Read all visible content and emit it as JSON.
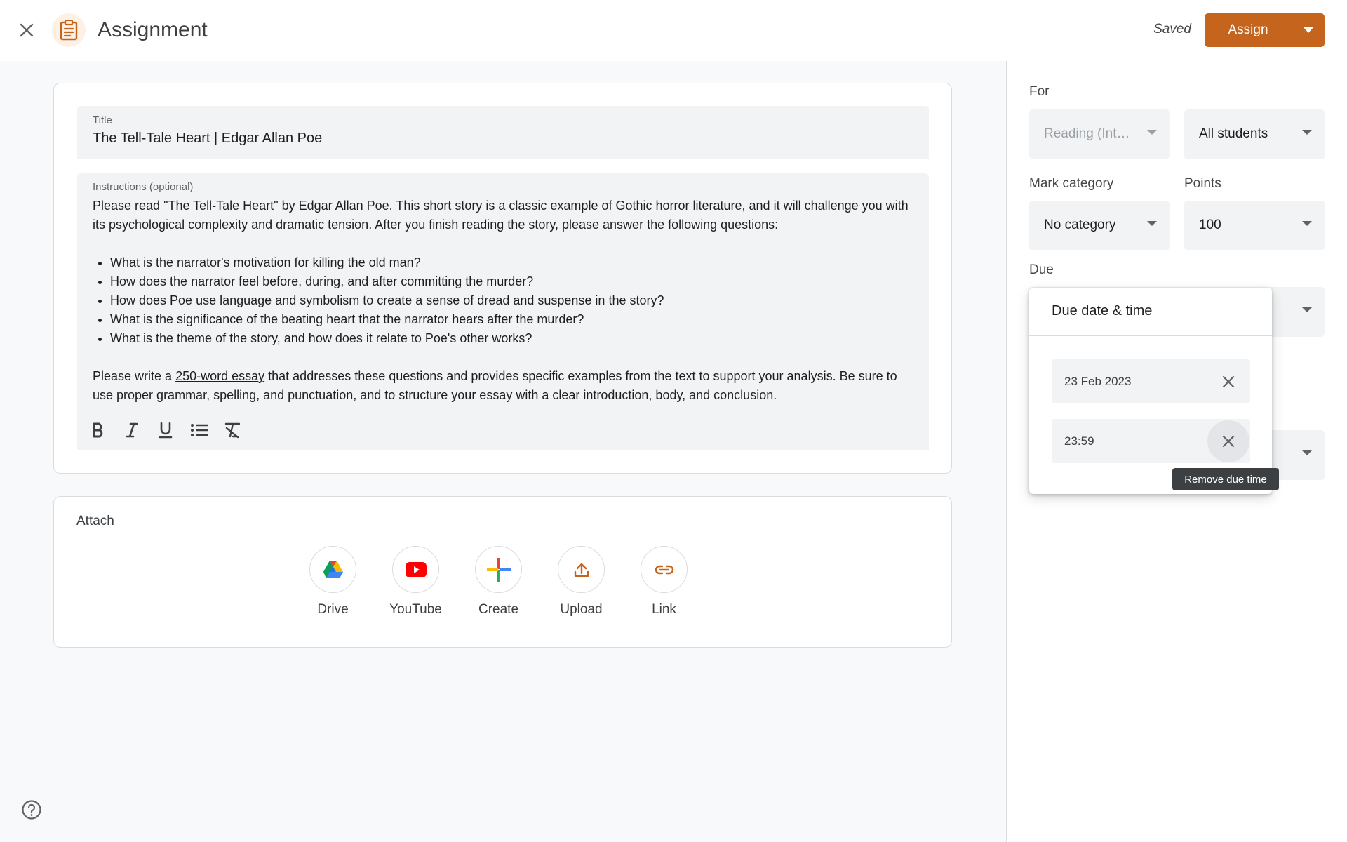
{
  "header": {
    "title": "Assignment",
    "status": "Saved",
    "assign_label": "Assign",
    "icons": {
      "close": "close-icon",
      "app": "assignment-icon",
      "dropdown": "caret-down-icon"
    }
  },
  "details": {
    "title_label": "Title",
    "title_value": "The Tell-Tale Heart | Edgar Allan Poe",
    "instructions_label": "Instructions (optional)",
    "instructions_intro": "Please read \"The Tell-Tale Heart\" by Edgar Allan Poe. This short story is a classic example of Gothic horror literature, and it will challenge you with its psychological complexity and dramatic tension. After you finish reading the story, please answer the following questions:",
    "questions": [
      "What is the narrator's motivation for killing the old man?",
      "How does the narrator feel before, during, and after committing the murder?",
      "How does Poe use language and symbolism to create a sense of dread and suspense in the story?",
      "What is the significance of the beating heart that the narrator hears after the murder?",
      "What is the theme of the story, and how does it relate to Poe's other works?"
    ],
    "closing_prefix": "Please write a ",
    "closing_underlined": "250-word essay",
    "closing_suffix": " that addresses these questions and provides specific examples from the text to support your analysis. Be sure to use proper grammar, spelling, and punctuation, and to structure your essay with a clear introduction, body, and conclusion.",
    "toolbar": [
      "bold-icon",
      "italic-icon",
      "underline-icon",
      "bulleted-list-icon",
      "clear-formatting-icon"
    ]
  },
  "attach": {
    "title": "Attach",
    "items": [
      {
        "label": "Drive",
        "icon": "drive-icon"
      },
      {
        "label": "YouTube",
        "icon": "youtube-icon"
      },
      {
        "label": "Create",
        "icon": "plus-icon"
      },
      {
        "label": "Upload",
        "icon": "upload-icon"
      },
      {
        "label": "Link",
        "icon": "link-icon"
      }
    ]
  },
  "sidebar": {
    "for_label": "For",
    "class_value": "Reading (Int…",
    "students_value": "All students",
    "category_label": "Mark category",
    "category_value": "No category",
    "points_label": "Points",
    "points_value": "100",
    "due_label": "Due"
  },
  "due_popover": {
    "title": "Due date & time",
    "date_value": "23 Feb 2023",
    "time_value": "23:59",
    "tooltip": "Remove due time"
  },
  "colors": {
    "accent": "#c5641d",
    "app_icon_bg": "#fdf0e4",
    "field_bg": "#f1f3f4",
    "youtube_red": "#ff0000"
  }
}
